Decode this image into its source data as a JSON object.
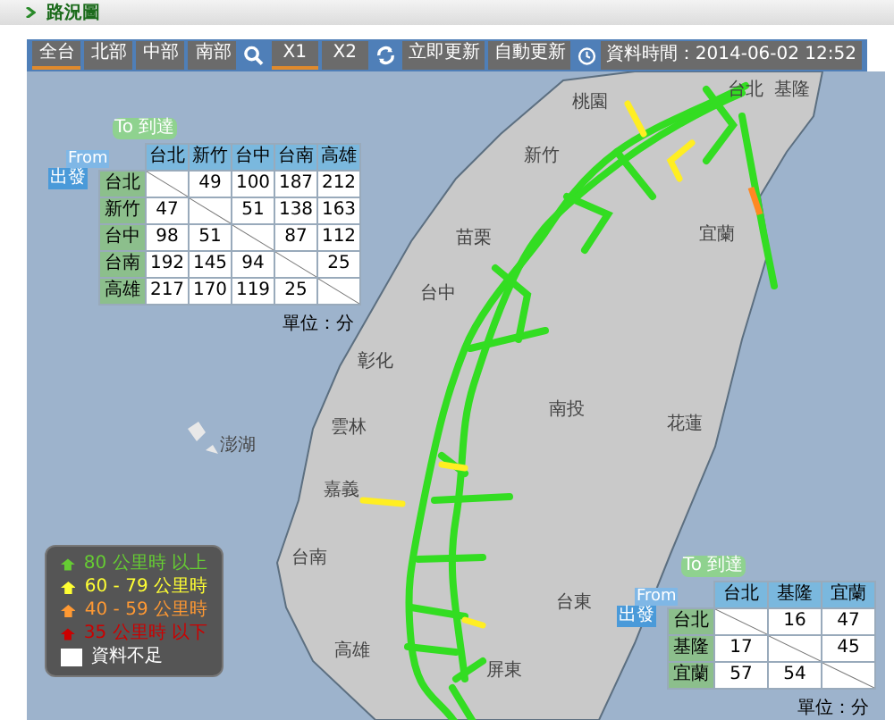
{
  "page_title": "路況圖",
  "regions": [
    {
      "label": "全台",
      "selected": true
    },
    {
      "label": "北部",
      "selected": false
    },
    {
      "label": "中部",
      "selected": false
    },
    {
      "label": "南部",
      "selected": false
    }
  ],
  "zooms": [
    {
      "label": "X1",
      "selected": true
    },
    {
      "label": "X2",
      "selected": false
    }
  ],
  "actions": [
    "立即更新",
    "自動更新"
  ],
  "data_time": "資料時間：2014-06-02 12:52",
  "map_labels": [
    "台北",
    "基隆",
    "桃園",
    "新竹",
    "宜蘭",
    "苗栗",
    "台中",
    "彰化",
    "南投",
    "花蓮",
    "雲林",
    "澎湖",
    "嘉義",
    "台南",
    "台東",
    "高雄",
    "屏東"
  ],
  "tables": [
    {
      "to_label": "To 到達",
      "from_label": "From",
      "from_label_2": "出發",
      "columns": [
        "台北",
        "新竹",
        "台中",
        "台南",
        "高雄"
      ],
      "unit": "單位：分",
      "rows": [
        {
          "name": "台北",
          "cells": [
            null,
            "49",
            "100",
            "187",
            "212"
          ]
        },
        {
          "name": "新竹",
          "cells": [
            "47",
            null,
            "51",
            "138",
            "163"
          ]
        },
        {
          "name": "台中",
          "cells": [
            "98",
            "51",
            null,
            "87",
            "112"
          ]
        },
        {
          "name": "台南",
          "cells": [
            "192",
            "145",
            "94",
            null,
            "25"
          ]
        },
        {
          "name": "高雄",
          "cells": [
            "217",
            "170",
            "119",
            "25",
            null
          ]
        }
      ]
    },
    {
      "to_label": "To 到達",
      "from_label": "From",
      "from_label_2": "出發",
      "columns": [
        "台北",
        "基隆",
        "宜蘭"
      ],
      "unit": "單位：分",
      "rows": [
        {
          "name": "台北",
          "cells": [
            null,
            "16",
            "47"
          ]
        },
        {
          "name": "基隆",
          "cells": [
            "17",
            null,
            "45"
          ]
        },
        {
          "name": "宜蘭",
          "cells": [
            "57",
            "54",
            null
          ]
        }
      ]
    }
  ],
  "legend": [
    {
      "label": "80 公里時 以上",
      "color": "#66cc33"
    },
    {
      "label": "60 - 79 公里時",
      "color": "#ffff33"
    },
    {
      "label": "40 - 59 公里時",
      "color": "#ff9933"
    },
    {
      "label": "35 公里時 以下",
      "color": "#cc0000"
    },
    {
      "label": "資料不足",
      "color": "#ffffff"
    }
  ]
}
